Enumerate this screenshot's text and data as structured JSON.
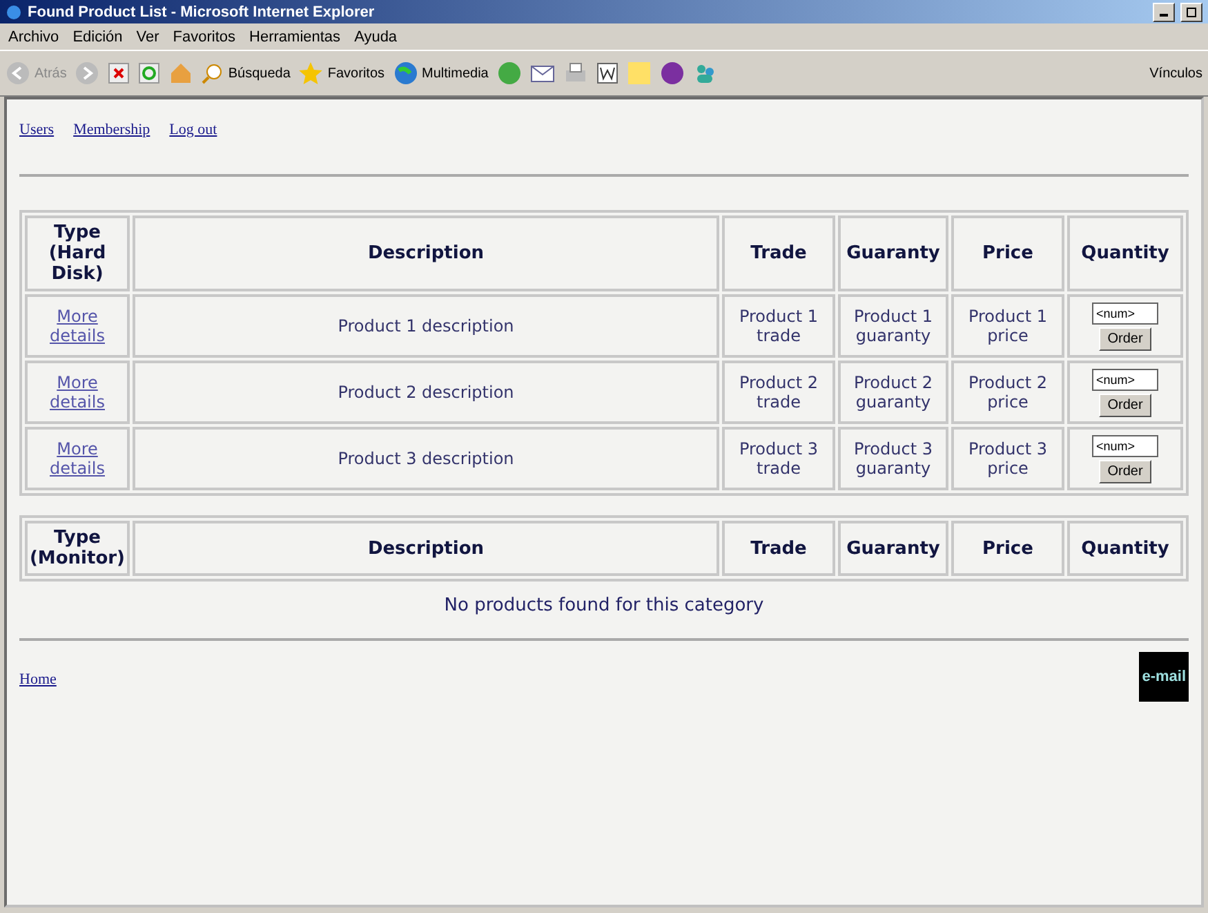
{
  "window": {
    "title": "Found Product List - Microsoft Internet Explorer"
  },
  "menu": [
    "Archivo",
    "Edición",
    "Ver",
    "Favoritos",
    "Herramientas",
    "Ayuda"
  ],
  "toolbar": {
    "back": "Atrás",
    "search": "Búsqueda",
    "favorites": "Favoritos",
    "media": "Multimedia",
    "links": "Vínculos"
  },
  "nav_links": [
    "Users",
    "Membership",
    "Log out"
  ],
  "tables": [
    {
      "columns": [
        "Type (Hard Disk)",
        "Description",
        "Trade",
        "Guaranty",
        "Price",
        "Quantity"
      ],
      "rows": [
        {
          "link": "More details",
          "description": "Product 1 description",
          "trade": "Product 1 trade",
          "guaranty": "Product 1 guaranty",
          "price": "Product 1 price",
          "quantity": {
            "placeholder": "<num>",
            "button": "Order"
          }
        },
        {
          "link": "More details",
          "description": "Product 2 description",
          "trade": "Product 2 trade",
          "guaranty": "Product 2 guaranty",
          "price": "Product 2 price",
          "quantity": {
            "placeholder": "<num>",
            "button": "Order"
          }
        },
        {
          "link": "More details",
          "description": "Product 3 description",
          "trade": "Product 3 trade",
          "guaranty": "Product 3 guaranty",
          "price": "Product 3 price",
          "quantity": {
            "placeholder": "<num>",
            "button": "Order"
          }
        }
      ]
    },
    {
      "columns": [
        "Type (Monitor)",
        "Description",
        "Trade",
        "Guaranty",
        "Price",
        "Quantity"
      ],
      "empty_message": "No products found for this category"
    }
  ],
  "footer": {
    "home": "Home",
    "email": "e-mail"
  }
}
